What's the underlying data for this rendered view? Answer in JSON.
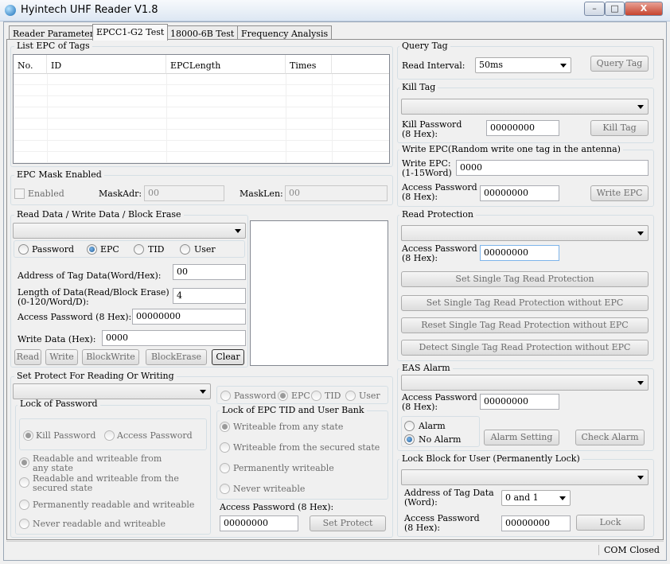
{
  "window": {
    "title": "Hyintech UHF Reader V1.8",
    "minimize": "–",
    "maximize": "□",
    "close": "X"
  },
  "tabs": [
    "Reader Parameter",
    "EPCC1-G2 Test",
    "18000-6B Test",
    "Frequency Analysis"
  ],
  "list_epc": {
    "title": "List EPC of Tags",
    "columns": [
      "No.",
      "ID",
      "EPCLength",
      "Times"
    ]
  },
  "epc_mask": {
    "title": "EPC Mask Enabled",
    "enabled_label": "Enabled",
    "maskadr_label": "MaskAdr:",
    "maskadr_value": "00",
    "masklen_label": "MaskLen:",
    "masklen_value": "00"
  },
  "rw": {
    "title": "Read Data / Write Data / Block Erase",
    "bank_options": [
      "Password",
      "EPC",
      "TID",
      "User"
    ],
    "address_label": "Address of Tag Data(Word/Hex):",
    "address_value": "00",
    "length_label_1": "Length of Data(Read/Block Erase)",
    "length_label_2": "(0-120/Word/D):",
    "length_value": "4",
    "access_label": "Access Password (8 Hex):",
    "access_value": "00000000",
    "write_label": "Write Data (Hex):",
    "write_value": "0000",
    "buttons": [
      "Read",
      "Write",
      "BlockWrite",
      "BlockErase",
      "Clear"
    ]
  },
  "protect": {
    "title": "Set Protect For Reading Or Writing",
    "lock_password_title": "Lock of Password",
    "kill_password": "Kill Password",
    "access_password": "Access Password",
    "pw_options": [
      [
        "Readable and  writeable from",
        "any state"
      ],
      [
        "Readable and writeable from the",
        "secured state"
      ],
      [
        "Permanently readable and writeable"
      ],
      [
        "Never readable and writeable"
      ]
    ],
    "bank_options": [
      "Password",
      "EPC",
      "TID",
      "User"
    ],
    "lock_bank_title": "Lock of EPC TID and User Bank",
    "bank_lock_options": [
      "Writeable from any state",
      "Writeable from the secured state",
      "Permanently writeable",
      "Never writeable"
    ],
    "access_label": "Access Password (8 Hex):",
    "access_value": "00000000",
    "set_button": "Set Protect"
  },
  "query": {
    "title": "Query Tag",
    "interval_label": "Read Interval:",
    "interval_value": "50ms",
    "button": "Query Tag"
  },
  "kill": {
    "title": "Kill Tag",
    "pw_label_1": "Kill Password",
    "pw_label_2": "(8 Hex):",
    "pw_value": "00000000",
    "button": "Kill Tag"
  },
  "write_epc": {
    "title": "Write EPC(Random write one tag in the antenna)",
    "epc_label_1": "Write EPC:",
    "epc_label_2": "(1-15Word)",
    "epc_value": "0000",
    "pw_label_1": "Access Password",
    "pw_label_2": "(8 Hex):",
    "pw_value": "00000000",
    "button": "Write EPC"
  },
  "read_protect": {
    "title": "Read Protection",
    "pw_label_1": "Access Password",
    "pw_label_2": "(8 Hex):",
    "pw_value": "00000000",
    "buttons": [
      "Set Single Tag Read Protection",
      "Set Single Tag Read Protection without EPC",
      "Reset Single Tag Read Protection without EPC",
      "Detect Single Tag Read Protection without EPC"
    ]
  },
  "eas": {
    "title": "EAS Alarm",
    "pw_label_1": "Access Password",
    "pw_label_2": "(8 Hex):",
    "pw_value": "00000000",
    "alarm": "Alarm",
    "no_alarm": "No Alarm",
    "setting_button": "Alarm Setting",
    "check_button": "Check Alarm"
  },
  "lock_block": {
    "title": "Lock Block for User (Permanently Lock)",
    "addr_label_1": "Address of Tag Data",
    "addr_label_2": "(Word):",
    "addr_value": "0 and 1",
    "pw_label_1": "Access Password",
    "pw_label_2": "(8 Hex):",
    "pw_value": "00000000",
    "button": "Lock"
  },
  "status": {
    "com": "COM Closed"
  }
}
